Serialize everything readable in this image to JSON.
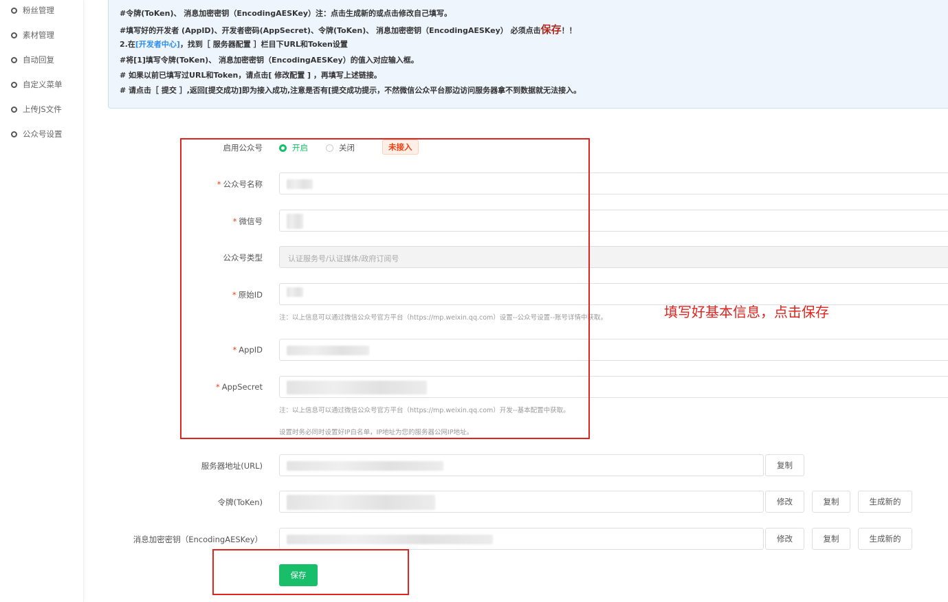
{
  "sidebar": {
    "items": [
      {
        "label": "粉丝管理"
      },
      {
        "label": "素材管理"
      },
      {
        "label": "自动回复"
      },
      {
        "label": "自定义菜单"
      },
      {
        "label": "上传JS文件"
      },
      {
        "label": "公众号设置"
      }
    ]
  },
  "notice": {
    "line1": "#令牌(ToKen)、 消息加密密钥（EncodingAESKey）注：点击生成新的或点击修改自己填写。",
    "line2_pre": "#填写好的开发者 (AppID)、开发者密码(AppSecret)、令牌(ToKen)、 消息加密密钥（EncodingAESKey） 必须点击",
    "line2_big": "保存",
    "line2_post": "！！",
    "line3_pre": "2.在",
    "line3_link": "[开发者中心]",
    "line3_post": "，找到［ 服务器配置 ］栏目下URL和Token设置",
    "line4": "#将[1]填写令牌(ToKen)、 消息加密密钥（EncodingAESKey）的值入对应输入框。",
    "line5": "# 如果以前已填写过URL和Token，请点击[ 修改配置 ] ，再填写上述链接。",
    "line6": "# 请点击［ 提交 ］,返回[提交成功]即为接入成功,注意是否有[提交成功提示，不然微信公众平台那边访问服务器拿不到数据就无法接入。"
  },
  "form": {
    "enable_label": "启用公众号",
    "enable_on": "开启",
    "enable_off": "关闭",
    "status_tag": "未接入",
    "name_label": "公众号名称",
    "wechat_label": "微信号",
    "type_label": "公众号类型",
    "type_placeholder": "认证服务号/认证媒体/政府订阅号",
    "origin_label": "原始ID",
    "note1": "注：以上信息可以通过微信公众号官方平台（https://mp.weixin.qq.com）设置--公众号设置--账号详情中获取。",
    "appid_label": "AppID",
    "secret_label": "AppSecret",
    "note2": "注：以上信息可以通过微信公众号官方平台（https://mp.weixin.qq.com）开发--基本配置中获取。",
    "note3": "设置时务必同时设置好IP白名单，IP地址为您的服务器公网IP地址。",
    "url_label": "服务器地址(URL)",
    "token_label": "令牌(ToKen)",
    "aes_label": "消息加密密钥（EncodingAESKey）",
    "copy": "复制",
    "edit": "修改",
    "generate": "生成新的",
    "save": "保存"
  },
  "annotation": {
    "text": "填写好基本信息，点击保存",
    "color": "#e0231c"
  },
  "colors": {
    "accent": "#19be6b",
    "notice_bg": "#eef5fd",
    "link": "#2d8cf0",
    "danger": "#ed4014"
  }
}
